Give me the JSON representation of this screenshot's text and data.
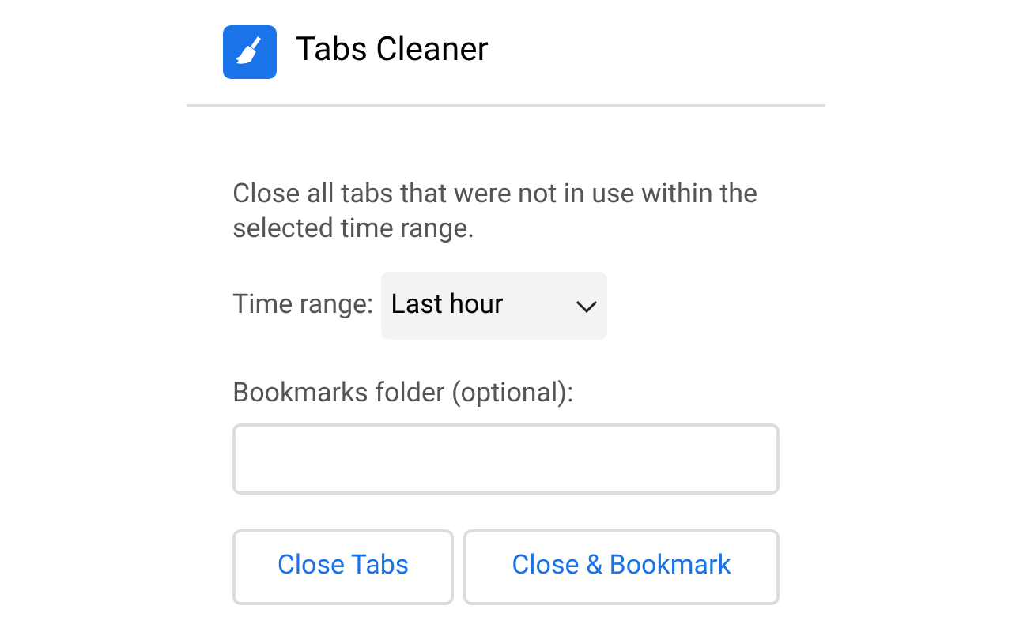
{
  "header": {
    "title": "Tabs Cleaner"
  },
  "description": "Close all tabs that were not in use within the selected time range.",
  "time_range": {
    "label": "Time range:",
    "value": "Last hour"
  },
  "bookmarks_folder": {
    "label": "Bookmarks folder (optional):"
  },
  "buttons": [
    "Close Tabs",
    "Close & Bookmark"
  ]
}
